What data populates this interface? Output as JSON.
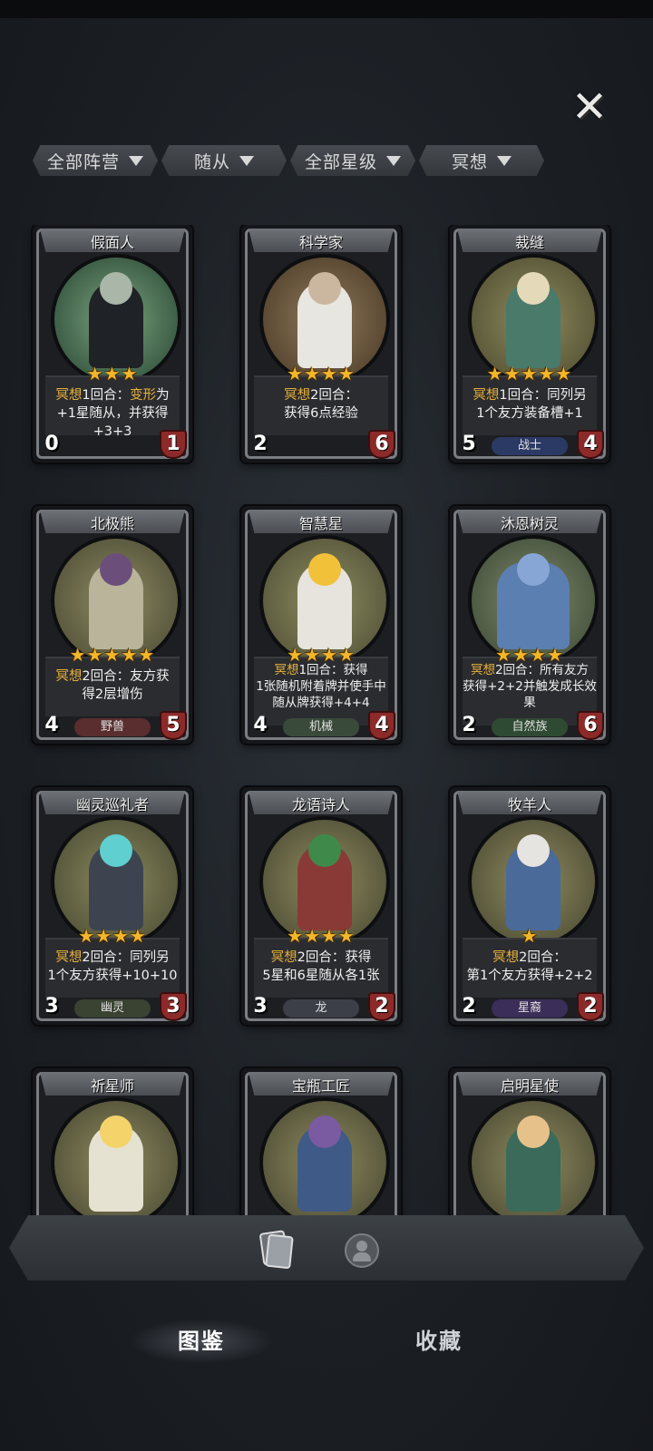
{
  "filters": [
    {
      "label": "全部阵营"
    },
    {
      "label": "随从"
    },
    {
      "label": "全部星级"
    },
    {
      "label": "冥想"
    }
  ],
  "cards": [
    {
      "name": "假面人",
      "stars": "★★★",
      "desc_kw": "冥想",
      "desc_a": "1回合：",
      "desc_kw2": "变形",
      "desc_b": "为",
      "desc_c": "+1星随从，并获得+3+3",
      "atk": "0",
      "hp": "1",
      "tribe": ""
    },
    {
      "name": "科学家",
      "stars": "★★★★",
      "desc_kw": "冥想",
      "desc_a": "2回合：",
      "desc_kw2": "",
      "desc_b": "",
      "desc_c": "获得6点经验",
      "atk": "2",
      "hp": "6",
      "tribe": ""
    },
    {
      "name": "裁缝",
      "stars": "★★★★★",
      "desc_kw": "冥想",
      "desc_a": "1回合：同列另",
      "desc_kw2": "",
      "desc_b": "",
      "desc_c": "1个友方装备槽+1",
      "atk": "5",
      "hp": "4",
      "tribe": "战士"
    },
    {
      "name": "北极熊",
      "stars": "★★★★★",
      "desc_kw": "冥想",
      "desc_a": "2回合：友方获",
      "desc_kw2": "",
      "desc_b": "",
      "desc_c": "得2层增伤",
      "atk": "4",
      "hp": "5",
      "tribe": "野兽"
    },
    {
      "name": "智慧星",
      "stars": "★★★★",
      "desc_kw": "冥想",
      "desc_a": "1回合：获得",
      "desc_kw2": "",
      "desc_b": "",
      "desc_c": "1张随机附着牌并使手中随从牌获得+4+4",
      "atk": "4",
      "hp": "4",
      "tribe": "机械"
    },
    {
      "name": "沐恩树灵",
      "stars": "★★★★",
      "desc_kw": "冥想",
      "desc_a": "2回合：所有友方",
      "desc_kw2": "",
      "desc_b": "",
      "desc_c": "获得+2+2并触发成长效果",
      "atk": "2",
      "hp": "6",
      "tribe": "自然族"
    },
    {
      "name": "幽灵巡礼者",
      "stars": "★★★★",
      "desc_kw": "冥想",
      "desc_a": "2回合：同列另",
      "desc_kw2": "",
      "desc_b": "",
      "desc_c": "1个友方获得+10+10",
      "atk": "3",
      "hp": "3",
      "tribe": "幽灵"
    },
    {
      "name": "龙语诗人",
      "stars": "★★★★",
      "desc_kw": "冥想",
      "desc_a": "2回合：获得",
      "desc_kw2": "",
      "desc_b": "",
      "desc_c": "5星和6星随从各1张",
      "atk": "3",
      "hp": "2",
      "tribe": "龙"
    },
    {
      "name": "牧羊人",
      "stars": "★",
      "desc_kw": "冥想",
      "desc_a": "2回合：",
      "desc_kw2": "",
      "desc_b": "",
      "desc_c": "第1个友方获得+2+2",
      "atk": "2",
      "hp": "2",
      "tribe": "星裔"
    },
    {
      "name": "祈星师",
      "stars": "",
      "desc_kw": "",
      "desc_a": "",
      "desc_kw2": "",
      "desc_b": "",
      "desc_c": "",
      "atk": "",
      "hp": "",
      "tribe": ""
    },
    {
      "name": "宝瓶工匠",
      "stars": "",
      "desc_kw": "",
      "desc_a": "",
      "desc_kw2": "",
      "desc_b": "",
      "desc_c": "",
      "atk": "",
      "hp": "",
      "tribe": ""
    },
    {
      "name": "启明星使",
      "stars": "",
      "desc_kw": "",
      "desc_a": "",
      "desc_kw2": "",
      "desc_b": "",
      "desc_c": "",
      "atk": "",
      "hp": "",
      "tribe": ""
    }
  ],
  "tabs": {
    "codex": "图鉴",
    "collection": "收藏"
  },
  "colors": {
    "star": "#f4b62a",
    "keyword": "#e7b13b",
    "hp": "#8c2a2a",
    "atk": "#2e5a8f"
  },
  "icons": {
    "close": "close-icon",
    "cards": "cards-icon",
    "profile": "profile-icon"
  }
}
